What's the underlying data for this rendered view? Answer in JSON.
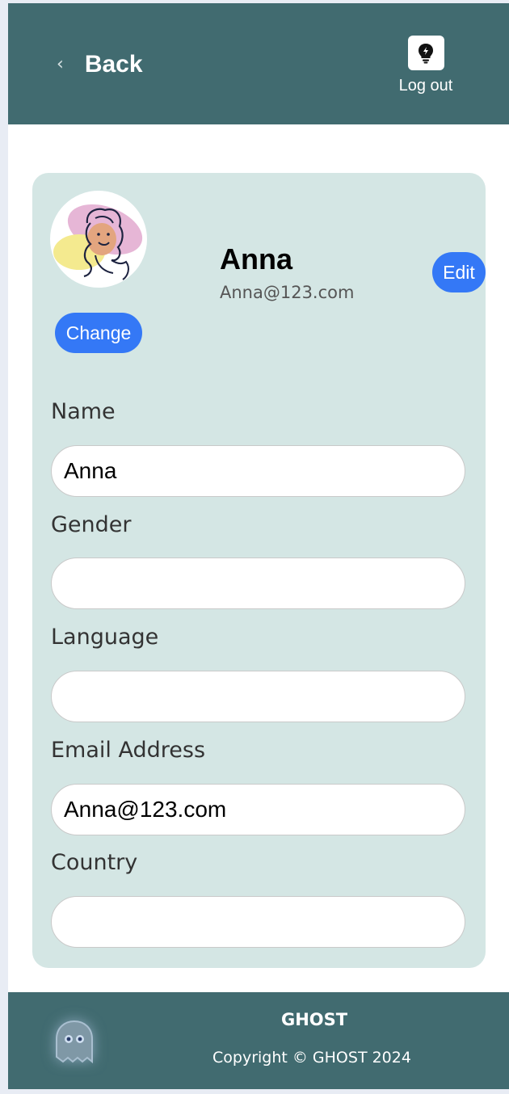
{
  "header": {
    "back_label": "Back",
    "logout_label": "Log out",
    "logout_icon": "lightbulb-bolt-icon"
  },
  "profile": {
    "name": "Anna",
    "email": "Anna@123.com",
    "change_label": "Change",
    "edit_label": "Edit",
    "avatar": "woman-illustration-avatar"
  },
  "form": {
    "fields": [
      {
        "label": "Name",
        "value": "Anna"
      },
      {
        "label": "Gender",
        "value": ""
      },
      {
        "label": "Language",
        "value": ""
      },
      {
        "label": "Email Address",
        "value": "Anna@123.com"
      },
      {
        "label": "Country",
        "value": ""
      }
    ]
  },
  "footer": {
    "brand": "GHOST",
    "copyright": "Copyright © GHOST 2024",
    "logo_icon": "ghost-icon"
  },
  "colors": {
    "header_bg": "#416b70",
    "card_bg": "#d4e6e4",
    "button_blue": "#3478f6"
  }
}
